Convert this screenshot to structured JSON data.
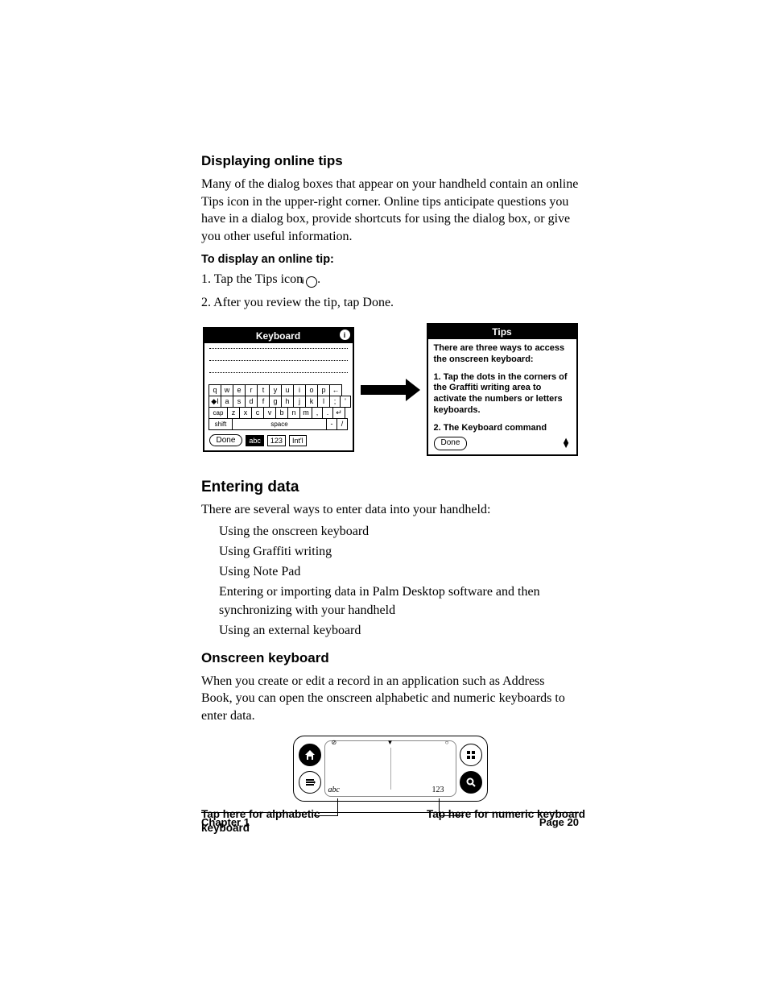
{
  "section1": {
    "heading": "Displaying online tips",
    "paragraph": "Many of the dialog boxes that appear on your handheld contain an online Tips icon in the upper-right corner. Online tips anticipate questions you have in a dialog box, provide shortcuts for using the dialog box, or give you other useful information.",
    "subhead": "To display an online tip:",
    "step1_pre": "1.  Tap the Tips icon ",
    "step1_post": ".",
    "step2": "2.  After you review the tip, tap Done."
  },
  "keyboard_dialog": {
    "title": "Keyboard",
    "row1": [
      "q",
      "w",
      "e",
      "r",
      "t",
      "y",
      "u",
      "i",
      "o",
      "p",
      "←"
    ],
    "row2": [
      "◆I",
      "a",
      "s",
      "d",
      "f",
      "g",
      "h",
      "j",
      "k",
      "l",
      ";",
      "'"
    ],
    "row3": [
      "cap",
      "z",
      "x",
      "c",
      "v",
      "b",
      "n",
      "m",
      ",",
      ".",
      "↵"
    ],
    "row4_shift": "shift",
    "row4_space": "space",
    "row4_dash": "-",
    "row4_slash": "/",
    "done": "Done",
    "tab_abc": "abc",
    "tab_123": "123",
    "tab_intl": "Int'l"
  },
  "tips_dialog": {
    "title": "Tips",
    "para1": "There are three ways to access the onscreen keyboard:",
    "para2": "1. Tap the dots in the corners of the Graffiti writing area to activate the numbers or letters keyboards.",
    "para3": "2. The Keyboard command",
    "done": "Done"
  },
  "section2": {
    "heading": "Entering data",
    "paragraph": "There are several ways to enter data into your handheld:",
    "bullets": [
      "Using the onscreen keyboard",
      "Using Graffiti writing",
      "Using Note Pad",
      "Entering or importing data in Palm Desktop software and then synchronizing with your handheld",
      "Using an external keyboard"
    ]
  },
  "section3": {
    "heading": "Onscreen keyboard",
    "paragraph": "When you create or edit a record in an application such as Address Book, you can open the onscreen alphabetic and numeric keyboards to enter data."
  },
  "graffiti_callouts": {
    "left": "Tap here for alphabetic keyboard",
    "right": "Tap here for numeric keyboard"
  },
  "footer": {
    "left": "Chapter 1",
    "right": "Page 20"
  }
}
